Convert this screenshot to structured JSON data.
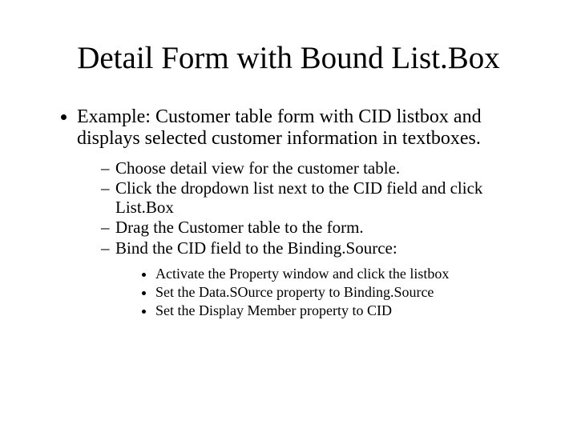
{
  "title": "Detail Form with Bound List.Box",
  "bullet1": "Example: Customer table form with CID listbox and displays selected customer information in textboxes.",
  "sub": {
    "s1": "Choose detail view for the customer table.",
    "s2": "Click the dropdown list next to the CID field and click List.Box",
    "s3": "Drag the Customer table to the form.",
    "s4": "Bind the CID field to the Binding.Source:"
  },
  "inner": {
    "i1": "Activate the Property window and click the listbox",
    "i2": "Set the Data.SOurce property to Binding.Source",
    "i3": "Set the Display Member property to CID"
  }
}
